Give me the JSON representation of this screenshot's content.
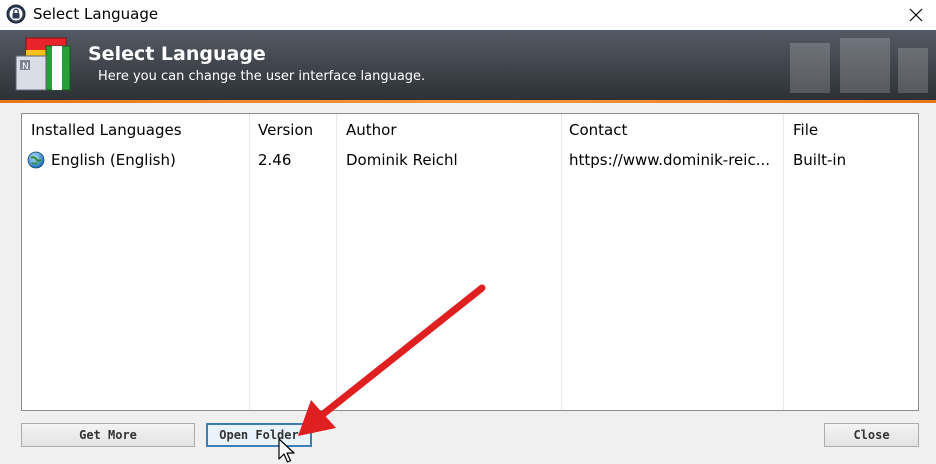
{
  "window": {
    "title": "Select Language",
    "close_icon": "close-x-icon"
  },
  "banner": {
    "title": "Select Language",
    "subtitle": "Here you can change the user interface language."
  },
  "list": {
    "columns": [
      "Installed Languages",
      "Version",
      "Author",
      "Contact",
      "File"
    ],
    "rows": [
      {
        "language": "English (English)",
        "version": "2.46",
        "author": "Dominik Reichl",
        "contact": "https://www.dominik-reic...",
        "file": "Built-in",
        "icon": "globe-icon"
      }
    ]
  },
  "buttons": {
    "get_more": "Get More",
    "open_folder": "Open Folder",
    "close": "Close"
  },
  "colors": {
    "banner_dark": "#3f444b",
    "accent_stripe": "#e8751a",
    "annotation_arrow": "#e02020",
    "focus_border": "#3c7fb1"
  }
}
